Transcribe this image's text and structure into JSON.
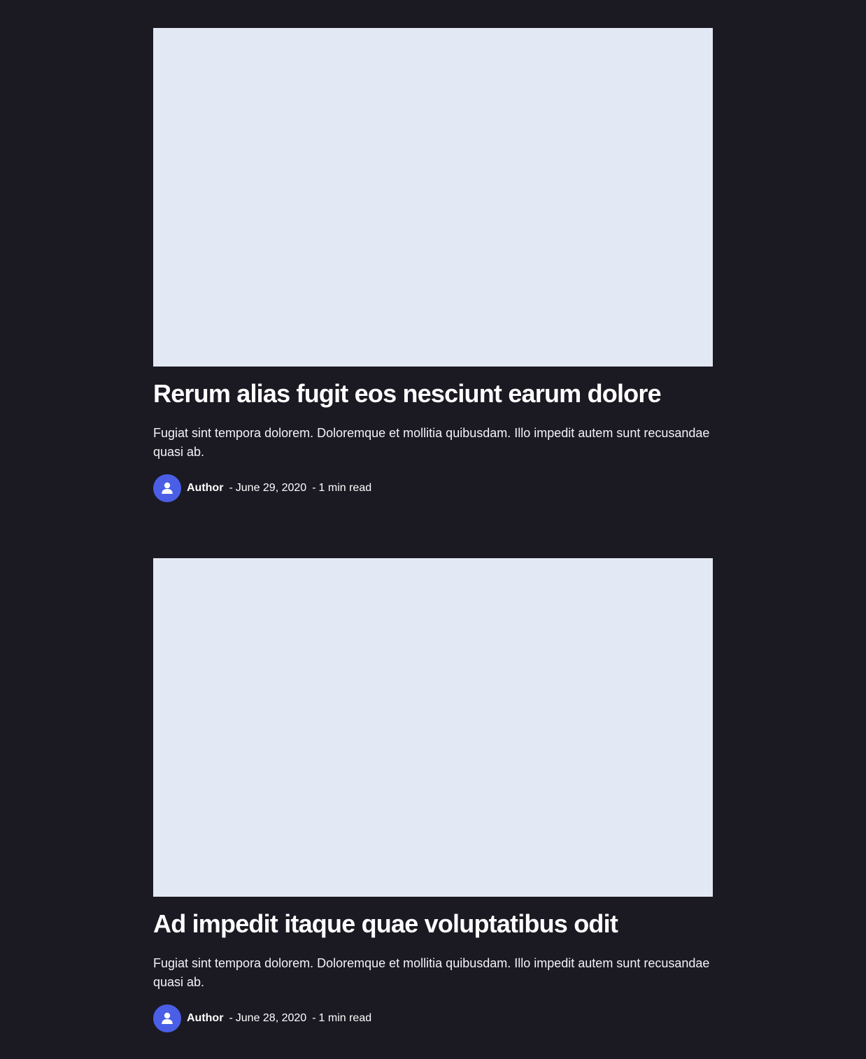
{
  "posts": [
    {
      "title": "Rerum alias fugit eos nesciunt earum dolore",
      "excerpt": "Fugiat sint tempora dolorem. Doloremque et mollitia quibusdam. Illo impedit autem sunt recusandae quasi ab.",
      "author": "Author",
      "separator": "-",
      "date": "June 29, 2020",
      "read_time": "1 min read",
      "avatar_icon": "user-icon"
    },
    {
      "title": "Ad impedit itaque quae voluptatibus odit",
      "excerpt": "Fugiat sint tempora dolorem. Doloremque et mollitia quibusdam. Illo impedit autem sunt recusandae quasi ab.",
      "author": "Author",
      "separator": "-",
      "date": "June 28, 2020",
      "read_time": "1 min read",
      "avatar_icon": "user-icon"
    }
  ],
  "colors": {
    "background": "#1b1a23",
    "image_placeholder": "#e2e8f4",
    "avatar": "#4a5fe6",
    "text": "#ffffff"
  }
}
